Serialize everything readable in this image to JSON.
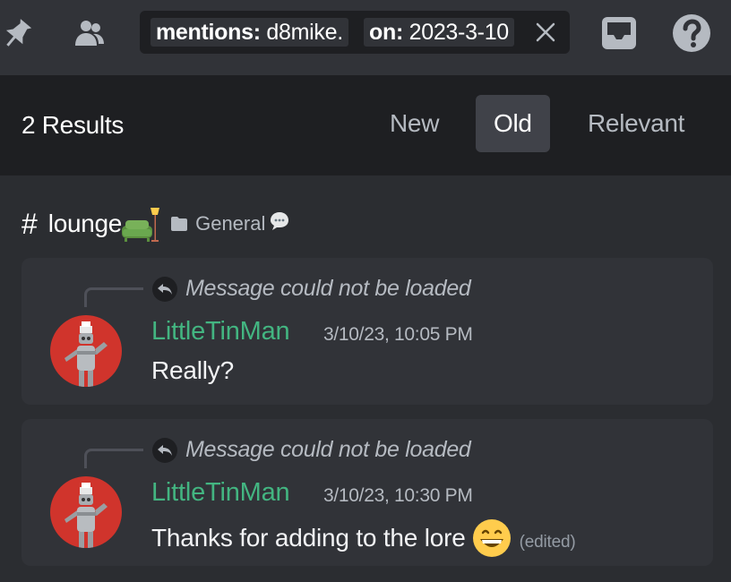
{
  "toolbar": {
    "icons": [
      "pin-icon",
      "members-icon",
      "inbox-icon",
      "help-icon"
    ],
    "search": {
      "mentions_key": "mentions:",
      "mentions_value": "d8mike.",
      "date_key": "on:",
      "date_value": "2023-3-10",
      "clear_icon": "close-icon"
    }
  },
  "results": {
    "count_label": "2 Results",
    "sort_tabs": [
      {
        "label": "New",
        "selected": false
      },
      {
        "label": "Old",
        "selected": true
      },
      {
        "label": "Relevant",
        "selected": false
      }
    ]
  },
  "channel": {
    "hash": "#",
    "name": "lounge",
    "name_emoji": "couch-and-lamp-icon",
    "category": "General",
    "category_icon": "folder-icon",
    "category_emoji": "speech-bubble-icon"
  },
  "messages": [
    {
      "reply_text": "Message could not be loaded",
      "author": "LittleTinMan",
      "timestamp": "3/10/23, 10:05 PM",
      "body": "Really?",
      "edited": ""
    },
    {
      "reply_text": "Message could not be loaded",
      "author": "LittleTinMan",
      "timestamp": "3/10/23, 10:30 PM",
      "body": "Thanks for adding to the lore",
      "emoji": "grinning-face-icon",
      "edited": "(edited)"
    }
  ],
  "colors": {
    "toolbar_bg": "#313338",
    "header_bg": "#1e1f22",
    "card_bg": "#313338",
    "page_bg": "#2b2d31",
    "author": "#43b581",
    "selected_tab": "#404249"
  }
}
